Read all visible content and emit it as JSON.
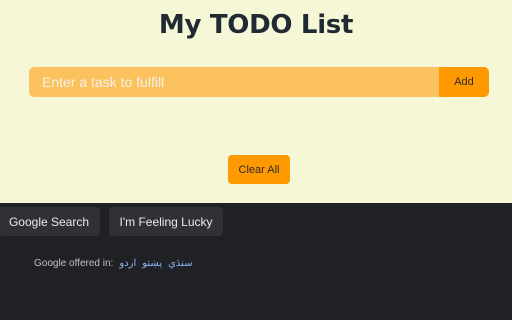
{
  "todo": {
    "title": "My TODO List",
    "input_placeholder": "Enter a task to fulfill",
    "input_value": "",
    "add_label": "Add",
    "clear_label": "Clear All"
  },
  "google": {
    "search_label": "Google Search",
    "lucky_label": "I'm Feeling Lucky",
    "offered_label": "Google offered in:",
    "languages": [
      "اردو",
      "پښتو",
      "سنڌي"
    ]
  },
  "colors": {
    "todo_background": "#f6f7d6",
    "input_background": "#fbc25e",
    "accent_orange": "#ff9900",
    "footer_background": "#202124",
    "footer_button": "#303134",
    "link_blue": "#8ab4f8"
  }
}
